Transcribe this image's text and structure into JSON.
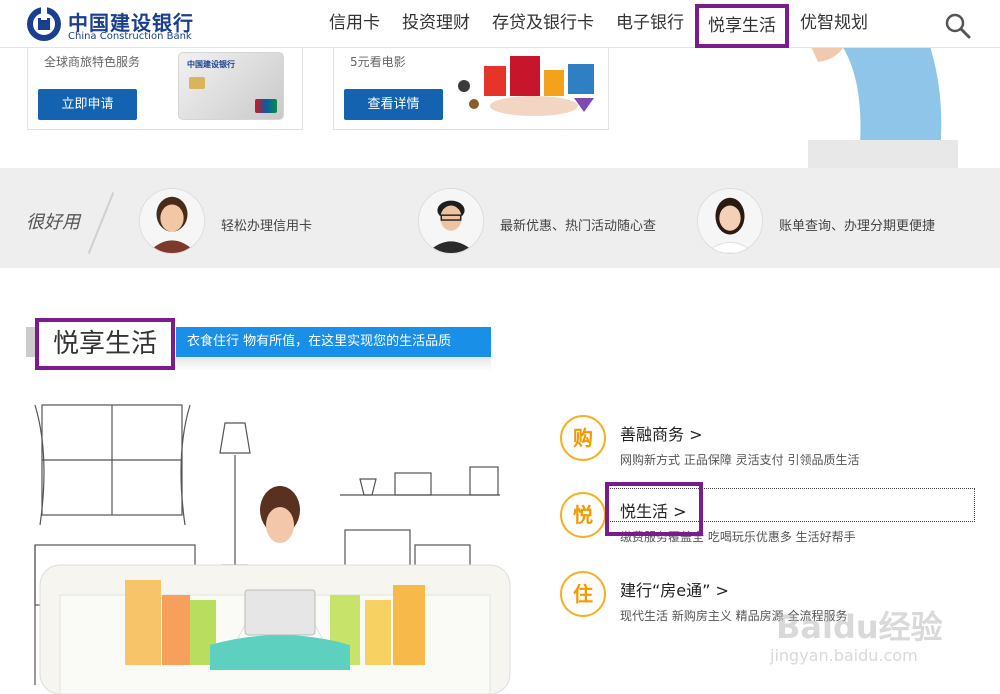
{
  "header": {
    "logo_cn": "中国建设银行",
    "logo_en": "China Construction Bank",
    "nav": [
      "信用卡",
      "投资理财",
      "存贷及银行卡",
      "电子银行",
      "悦享生活",
      "优智规划"
    ],
    "active_nav": "悦享生活"
  },
  "promo": [
    {
      "desc": "全球商旅特色服务",
      "button": "立即申请",
      "card_text": "中国建设银行"
    },
    {
      "desc": "5元看电影",
      "button": "查看详情"
    }
  ],
  "band": {
    "title": "很好用",
    "features": [
      "轻松办理信用卡",
      "最新优惠、热门活动随心查",
      "账单查询、办理分期更便捷"
    ]
  },
  "section": {
    "title": "悦享生活",
    "subtitle": "衣食住行 物有所值，在这里实现您的生活品质"
  },
  "items": [
    {
      "badge": "购",
      "title": "善融商务 >",
      "desc": "网购新方式 正品保障 灵活支付 引领品质生活"
    },
    {
      "badge": "悦",
      "title": "悦生活 >",
      "desc": "缴费服务覆盖全 吃喝玩乐优惠多 生活好帮手"
    },
    {
      "badge": "住",
      "title": "建行“房e通” >",
      "desc": "现代生活 新购房主义 精品房源 全流程服务"
    }
  ],
  "watermark": {
    "main": "Baidu经验",
    "sub": "jingyan.baidu.com"
  },
  "colors": {
    "brand_blue": "#1a3f8f",
    "button_blue": "#1463b1",
    "accent_purple": "#7b1c8e",
    "banner_blue": "#1a8fe8",
    "badge_orange": "#f6b024"
  }
}
